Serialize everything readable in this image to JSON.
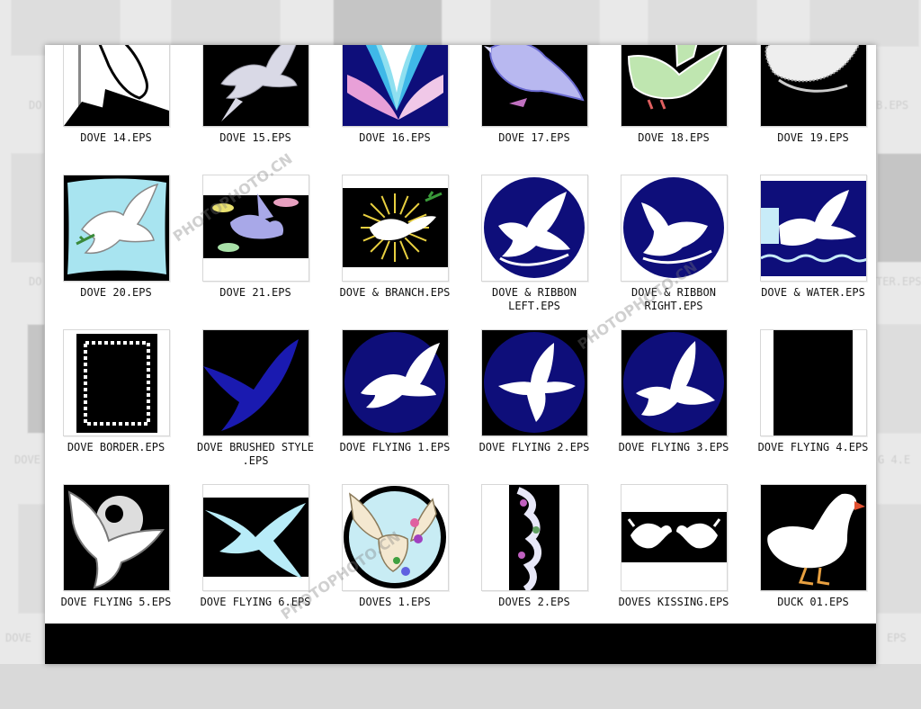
{
  "window": {
    "files": [
      {
        "label": "DOVE 14.EPS",
        "art": "dove-14"
      },
      {
        "label": "DOVE 15.EPS",
        "art": "dove-15"
      },
      {
        "label": "DOVE 16.EPS",
        "art": "dove-16"
      },
      {
        "label": "DOVE 17.EPS",
        "art": "dove-17"
      },
      {
        "label": "DOVE 18.EPS",
        "art": "dove-18"
      },
      {
        "label": "DOVE 19.EPS",
        "art": "dove-19"
      },
      {
        "label": "DOVE 20.EPS",
        "art": "dove-20"
      },
      {
        "label": "DOVE 21.EPS",
        "art": "dove-21"
      },
      {
        "label": "DOVE & BRANCH.EPS",
        "art": "dove-branch"
      },
      {
        "label": "DOVE & RIBBON LEFT.EPS",
        "art": "ribbon-left"
      },
      {
        "label": "DOVE & RIBBON RIGHT.EPS",
        "art": "ribbon-right"
      },
      {
        "label": "DOVE & WATER.EPS",
        "art": "dove-water"
      },
      {
        "label": "DOVE BORDER.EPS",
        "art": "dove-border"
      },
      {
        "label": "DOVE BRUSHED STYLE .EPS",
        "art": "dove-brushed"
      },
      {
        "label": "DOVE FLYING 1.EPS",
        "art": "flying-1"
      },
      {
        "label": "DOVE FLYING 2.EPS",
        "art": "flying-2"
      },
      {
        "label": "DOVE FLYING 3.EPS",
        "art": "flying-3"
      },
      {
        "label": "DOVE FLYING 4.EPS",
        "art": "flying-4"
      },
      {
        "label": "DOVE FLYING 5.EPS",
        "art": "flying-5"
      },
      {
        "label": "DOVE FLYING 6.EPS",
        "art": "flying-6"
      },
      {
        "label": "DOVES 1.EPS",
        "art": "doves-1"
      },
      {
        "label": "DOVES 2.EPS",
        "art": "doves-2"
      },
      {
        "label": "DOVES KISSING.EPS",
        "art": "doves-kissing"
      },
      {
        "label": "DUCK 01.EPS",
        "art": "duck-01"
      }
    ]
  },
  "background": {
    "labels": [
      "DO",
      "DO",
      "DOVE",
      "DO",
      "DOVE",
      "B.EPS",
      "TER.EPS",
      "G 4.E",
      "EPS"
    ]
  },
  "watermark": {
    "text": "PHOTOPHOTO.CN"
  },
  "colors": {
    "navy": "#0e0e7a",
    "black": "#000000",
    "white": "#ffffff"
  }
}
